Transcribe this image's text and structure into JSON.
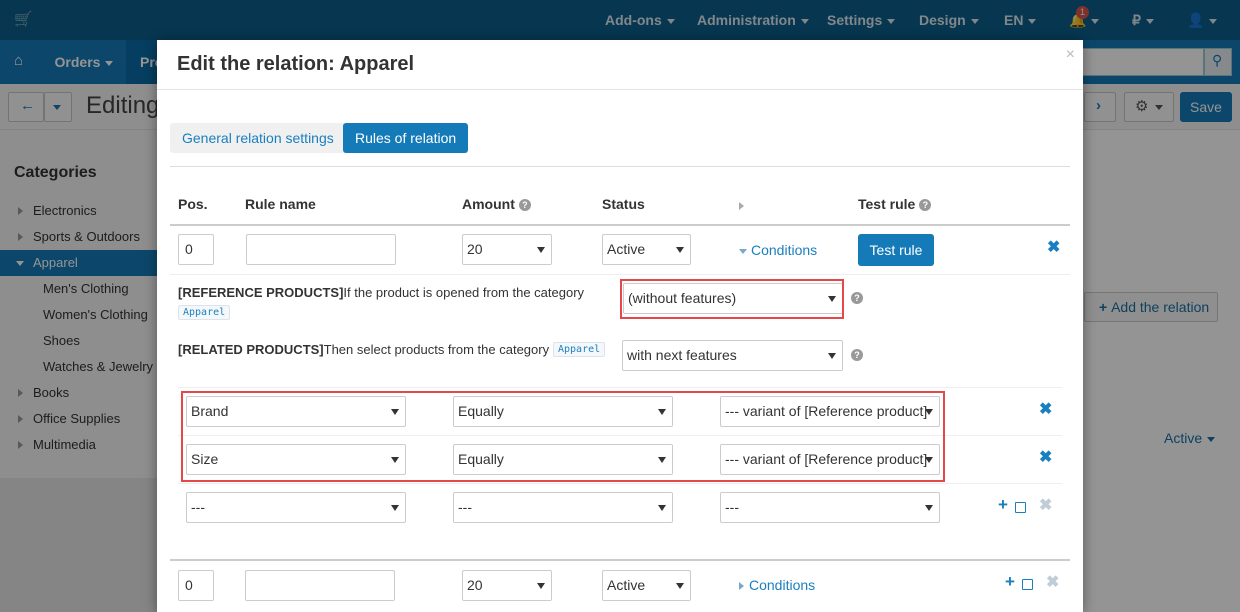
{
  "topbar": {
    "addons": "Add-ons",
    "administration": "Administration",
    "settings": "Settings",
    "design": "Design",
    "language": "EN",
    "notification_count": "1",
    "currency": "₽"
  },
  "navbar": {
    "orders": "Orders",
    "products_partial": "Pro"
  },
  "toolbar": {
    "title_partial": "Editing",
    "save": "Save"
  },
  "sidebar": {
    "title": "Categories",
    "items": [
      {
        "label": "Electronics"
      },
      {
        "label": "Sports & Outdoors"
      },
      {
        "label": "Apparel"
      },
      {
        "label": "Men's Clothing"
      },
      {
        "label": "Women's Clothing"
      },
      {
        "label": "Shoes"
      },
      {
        "label": "Watches & Jewelry"
      },
      {
        "label": "Books"
      },
      {
        "label": "Office Supplies"
      },
      {
        "label": "Multimedia"
      }
    ]
  },
  "background": {
    "add_relation": "Add the relation",
    "status_active": "Active"
  },
  "modal": {
    "title": "Edit the relation: Apparel",
    "close": "×",
    "tabs": {
      "general": "General relation settings",
      "rules": "Rules of relation"
    },
    "headers": {
      "pos": "Pos.",
      "rule_name": "Rule name",
      "amount": "Amount",
      "status": "Status",
      "test_rule": "Test rule"
    },
    "rule1": {
      "pos": "0",
      "name": "",
      "amount": "20",
      "status": "Active",
      "conditions": "Conditions",
      "test_button": "Test rule"
    },
    "reference": {
      "label": "[REFERENCE PRODUCTS]",
      "text": "If the product is opened from the category",
      "category": "Apparel",
      "select": "(without features)"
    },
    "related": {
      "label": "[RELATED PRODUCTS]",
      "text": "Then select products from the category",
      "category": "Apparel",
      "select": "with next features"
    },
    "features": [
      {
        "feature": "Brand",
        "operator": "Equally",
        "value": "--- variant of [Reference product]"
      },
      {
        "feature": "Size",
        "operator": "Equally",
        "value": "--- variant of [Reference product]"
      },
      {
        "feature": "---",
        "operator": "---",
        "value": "---"
      }
    ],
    "rule2": {
      "pos": "0",
      "name": "",
      "amount": "20",
      "status": "Active",
      "conditions": "Conditions"
    }
  },
  "colors": {
    "primary": "#157ab8",
    "topbar": "#0b5e8a",
    "highlight": "#e5474a"
  }
}
